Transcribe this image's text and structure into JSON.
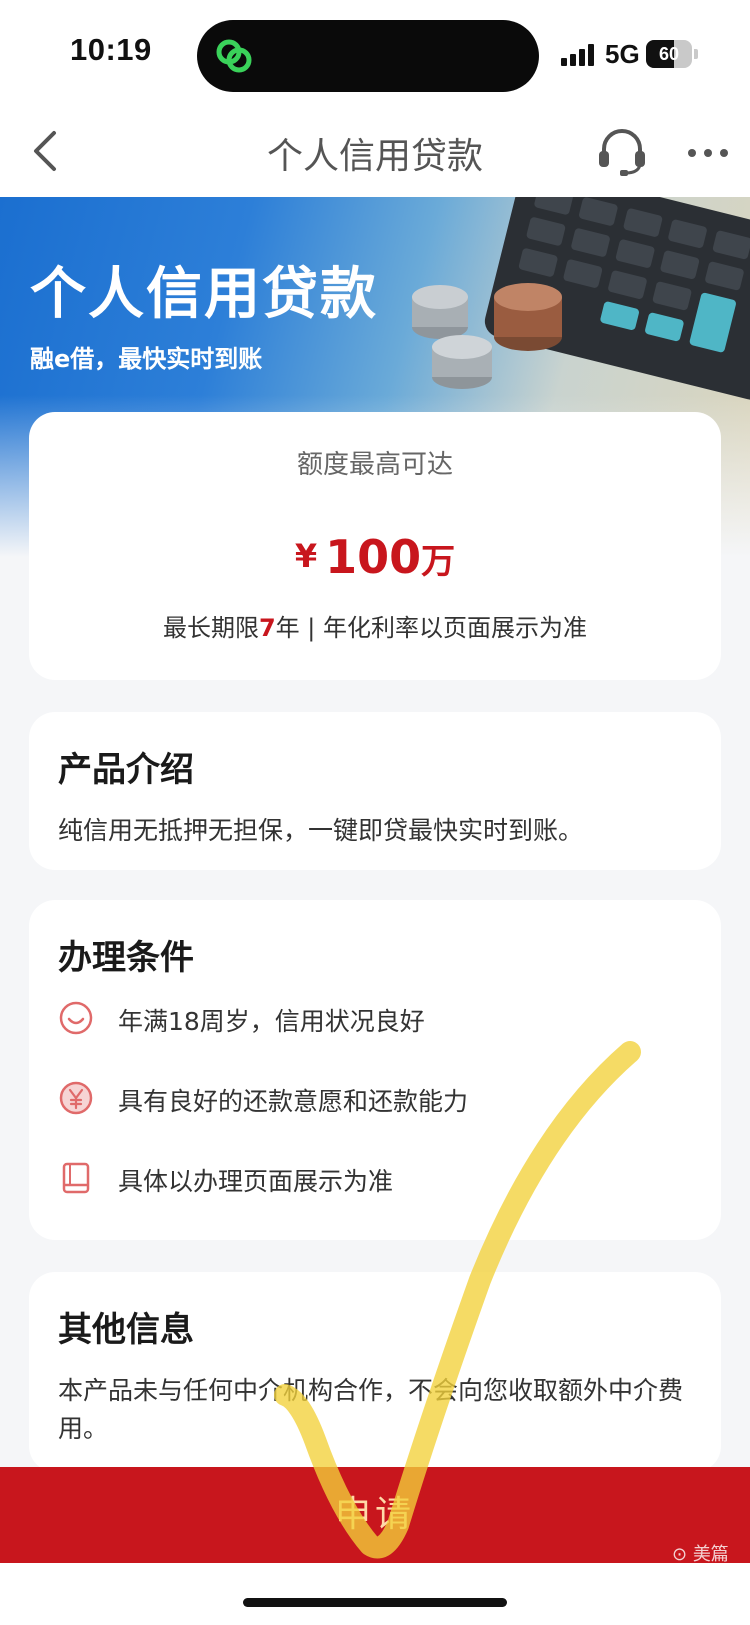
{
  "status_bar": {
    "time": "10:19",
    "network": "5G",
    "battery": "60",
    "battery_level_percent": 60,
    "island_app_icon": "chain-link-icon"
  },
  "nav": {
    "title": "个人信用贷款",
    "back_icon": "chevron-left-icon",
    "service_icon": "headset-icon",
    "more_icon": "more-dots-icon"
  },
  "banner": {
    "title": "个人信用贷款",
    "subtitle": "融e借，最快实时到账"
  },
  "quota": {
    "label": "额度最高可达",
    "currency": "¥",
    "amount": "100",
    "unit": "万",
    "terms_prefix": "最长期限",
    "terms_years": "7",
    "terms_suffix": "年 | 年化利率以页面展示为准"
  },
  "intro": {
    "title": "产品介绍",
    "text": "纯信用无抵押无担保，一键即贷最快实时到账。"
  },
  "conditions": {
    "title": "办理条件",
    "items": [
      {
        "icon": "smile-icon",
        "text": "年满18周岁，信用状况良好"
      },
      {
        "icon": "yen-coin-icon",
        "text": "具有良好的还款意愿和还款能力"
      },
      {
        "icon": "book-icon",
        "text": "具体以办理页面展示为准"
      }
    ]
  },
  "other": {
    "title": "其他信息",
    "text": "本产品未与任何中介机构合作，不会向您收取额外中介费用。"
  },
  "apply": {
    "label": "申请"
  },
  "watermark": "美篇",
  "colors": {
    "brand_red": "#c8161d",
    "apply_text": "#ffd9a8",
    "handwritten_check": "#f2d13a"
  }
}
